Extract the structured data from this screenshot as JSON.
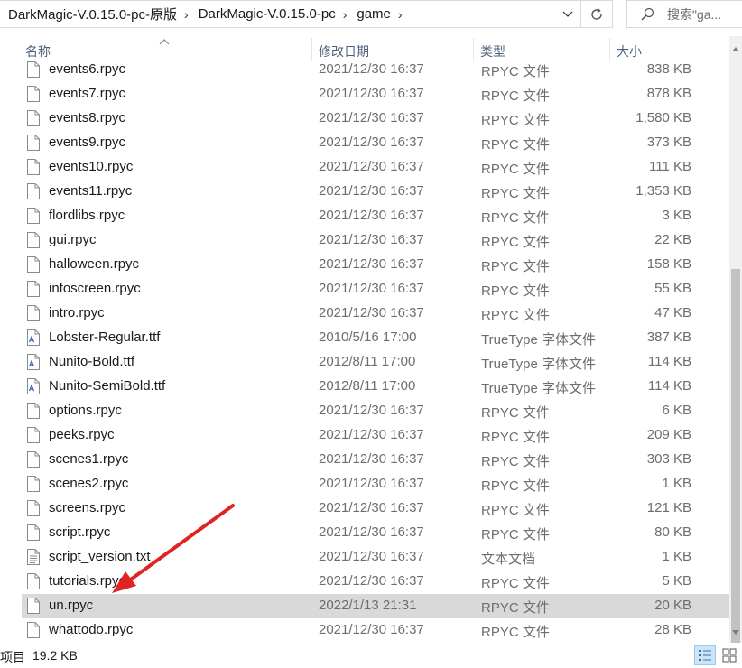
{
  "address_bar": {
    "breadcrumbs": [
      "DarkMagic-V.0.15.0-pc-原版",
      "DarkMagic-V.0.15.0-pc",
      "game"
    ]
  },
  "search": {
    "placeholder": "搜索\"ga..."
  },
  "columns": {
    "name": "名称",
    "date": "修改日期",
    "type": "类型",
    "size": "大小"
  },
  "files": [
    {
      "name": "events6.rpyc",
      "date": "2021/12/30 16:37",
      "type": "RPYC 文件",
      "size": "838 KB",
      "icon": "file-icon"
    },
    {
      "name": "events7.rpyc",
      "date": "2021/12/30 16:37",
      "type": "RPYC 文件",
      "size": "878 KB",
      "icon": "file-icon"
    },
    {
      "name": "events8.rpyc",
      "date": "2021/12/30 16:37",
      "type": "RPYC 文件",
      "size": "1,580 KB",
      "icon": "file-icon"
    },
    {
      "name": "events9.rpyc",
      "date": "2021/12/30 16:37",
      "type": "RPYC 文件",
      "size": "373 KB",
      "icon": "file-icon"
    },
    {
      "name": "events10.rpyc",
      "date": "2021/12/30 16:37",
      "type": "RPYC 文件",
      "size": "111 KB",
      "icon": "file-icon"
    },
    {
      "name": "events11.rpyc",
      "date": "2021/12/30 16:37",
      "type": "RPYC 文件",
      "size": "1,353 KB",
      "icon": "file-icon"
    },
    {
      "name": "flordlibs.rpyc",
      "date": "2021/12/30 16:37",
      "type": "RPYC 文件",
      "size": "3 KB",
      "icon": "file-icon"
    },
    {
      "name": "gui.rpyc",
      "date": "2021/12/30 16:37",
      "type": "RPYC 文件",
      "size": "22 KB",
      "icon": "file-icon"
    },
    {
      "name": "halloween.rpyc",
      "date": "2021/12/30 16:37",
      "type": "RPYC 文件",
      "size": "158 KB",
      "icon": "file-icon"
    },
    {
      "name": "infoscreen.rpyc",
      "date": "2021/12/30 16:37",
      "type": "RPYC 文件",
      "size": "55 KB",
      "icon": "file-icon"
    },
    {
      "name": "intro.rpyc",
      "date": "2021/12/30 16:37",
      "type": "RPYC 文件",
      "size": "47 KB",
      "icon": "file-icon"
    },
    {
      "name": "Lobster-Regular.ttf",
      "date": "2010/5/16 17:00",
      "type": "TrueType 字体文件",
      "size": "387 KB",
      "icon": "font-file-icon"
    },
    {
      "name": "Nunito-Bold.ttf",
      "date": "2012/8/11 17:00",
      "type": "TrueType 字体文件",
      "size": "114 KB",
      "icon": "font-file-icon"
    },
    {
      "name": "Nunito-SemiBold.ttf",
      "date": "2012/8/11 17:00",
      "type": "TrueType 字体文件",
      "size": "114 KB",
      "icon": "font-file-icon"
    },
    {
      "name": "options.rpyc",
      "date": "2021/12/30 16:37",
      "type": "RPYC 文件",
      "size": "6 KB",
      "icon": "file-icon"
    },
    {
      "name": "peeks.rpyc",
      "date": "2021/12/30 16:37",
      "type": "RPYC 文件",
      "size": "209 KB",
      "icon": "file-icon"
    },
    {
      "name": "scenes1.rpyc",
      "date": "2021/12/30 16:37",
      "type": "RPYC 文件",
      "size": "303 KB",
      "icon": "file-icon"
    },
    {
      "name": "scenes2.rpyc",
      "date": "2021/12/30 16:37",
      "type": "RPYC 文件",
      "size": "1 KB",
      "icon": "file-icon"
    },
    {
      "name": "screens.rpyc",
      "date": "2021/12/30 16:37",
      "type": "RPYC 文件",
      "size": "121 KB",
      "icon": "file-icon"
    },
    {
      "name": "script.rpyc",
      "date": "2021/12/30 16:37",
      "type": "RPYC 文件",
      "size": "80 KB",
      "icon": "file-icon"
    },
    {
      "name": "script_version.txt",
      "date": "2021/12/30 16:37",
      "type": "文本文档",
      "size": "1 KB",
      "icon": "text-file-icon"
    },
    {
      "name": "tutorials.rpyc",
      "date": "2021/12/30 16:37",
      "type": "RPYC 文件",
      "size": "5 KB",
      "icon": "file-icon"
    },
    {
      "name": "un.rpyc",
      "date": "2022/1/13 21:31",
      "type": "RPYC 文件",
      "size": "20 KB",
      "icon": "file-icon",
      "selected": true
    },
    {
      "name": "whattodo.rpyc",
      "date": "2021/12/30 16:37",
      "type": "RPYC 文件",
      "size": "28 KB",
      "icon": "file-icon"
    }
  ],
  "status_bar": {
    "item_count": "项目",
    "selection_size": "19.2 KB"
  },
  "colors": {
    "selected_row": "#d9d9d9",
    "annotation_arrow": "#e02424",
    "header_text": "#4c607a"
  }
}
